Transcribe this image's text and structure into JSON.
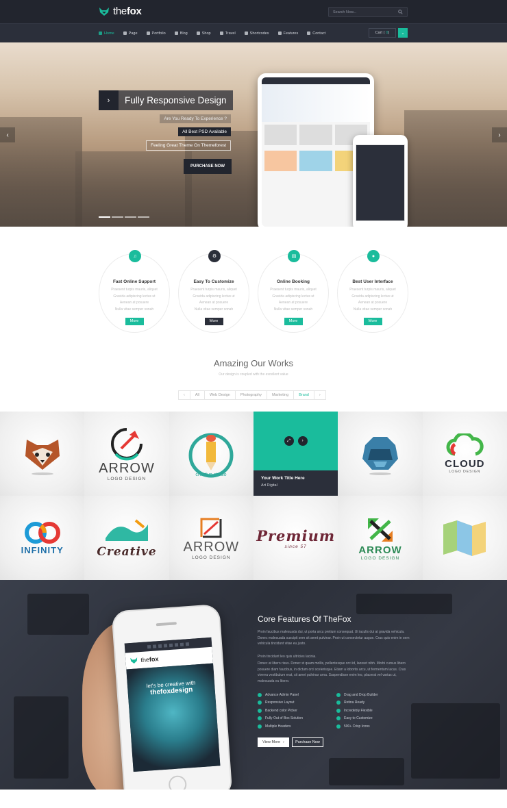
{
  "brand": {
    "name_light": "the",
    "name_bold": "fox",
    "accent": "#1abc9c",
    "dark": "#22252e"
  },
  "search": {
    "placeholder": "Search Now..."
  },
  "nav": {
    "items": [
      {
        "label": "Home",
        "icon": "home-icon"
      },
      {
        "label": "Page",
        "icon": "page-icon"
      },
      {
        "label": "Portfolio",
        "icon": "portfolio-icon"
      },
      {
        "label": "Blog",
        "icon": "blog-icon"
      },
      {
        "label": "Shop",
        "icon": "shop-icon"
      },
      {
        "label": "Travel",
        "icon": "travel-icon"
      },
      {
        "label": "Shortcodes",
        "icon": "shortcodes-icon"
      },
      {
        "label": "Features",
        "icon": "star-icon"
      },
      {
        "label": "Contact",
        "icon": "location-icon"
      }
    ],
    "cart_label": "Cart (",
    "cart_count": "0",
    "cart_close": ")"
  },
  "hero": {
    "title": "Fully Responsive Design",
    "tag1": "Are You Ready To Experience ?",
    "tag2": "All Best PSD Available",
    "tag3": "Feeling Great Theme On Themeforest",
    "button": "PURCHASE NOW",
    "slides_total": 4,
    "slide_active": 1
  },
  "features": [
    {
      "title": "Fast Online Support",
      "icon": "headphones-icon",
      "lines": [
        "Praesent turpis mauris, aliquet",
        "Gravida adipiscing lectus ut",
        "Aenean at posuere",
        "Nulla vitae semper sonah"
      ],
      "button": "More"
    },
    {
      "title": "Easy To Customize",
      "icon": "gear-icon",
      "lines": [
        "Praesent turpis mauris, aliquet",
        "Gravida adipiscing lectus ut",
        "Aenean at posuere",
        "Nulla vitae semper sonah"
      ],
      "button": "More"
    },
    {
      "title": "Online Booking",
      "icon": "book-icon",
      "lines": [
        "Praesent turpis mauris, aliquet",
        "Gravida adipiscing lectus ut",
        "Aenean at posuere",
        "Nulla vitae semper sonah"
      ],
      "button": "More"
    },
    {
      "title": "Best User Interface",
      "icon": "user-icon",
      "lines": [
        "Praesent turpis mauris, aliquet",
        "Gravida adipiscing lectus ut",
        "Aenean at posuere",
        "Nulla vitae semper sonah"
      ],
      "button": "More"
    }
  ],
  "works": {
    "title": "Amazing Our Works",
    "subtitle": "Our design is coupled with the excellent value",
    "filters": [
      "All",
      "Web Design",
      "Photography",
      "Marketing",
      "Brand"
    ],
    "active_filter": "Brand",
    "hover_title": "Your Work Title Here",
    "hover_sub": "Art Digital",
    "logos": {
      "arrow1": "ARROW",
      "arrow1_sub": "LOGO DESIGN",
      "creative_studio": "creative studio",
      "cloud": "CLOUD",
      "cloud_sub": "LOGO DESIGN",
      "infinity": "INFINITY",
      "creative": "Creative",
      "arrow2": "ARROW",
      "arrow2_sub": "LOGO DESIGN",
      "premium": "Premium",
      "premium_since": "since 57",
      "arrow3": "ARROW",
      "arrow3_sub": "LOGO DESIGN"
    }
  },
  "core": {
    "title": "Core Features Of TheFox",
    "p1": "Proin faucibus malesuada dui, ut porta arcu pretium consequat. Ut iaculis dui at gravida vehicula. Donec malesuada suscipit sem sit amet pulvinar. Proin ut consectetur augue. Cras quis enim in sem vehicula tincidunt vitae eu justo.",
    "p2": "Proin tincidunt leo quis ultricies lacinia.",
    "p3": "Donec at libero risus. Donec st quam mollis, pellentesque orci id, laoreet nibh. Morbi cursus libero posuere diam faucibus, in dictum orci scelerisque. Etiam a lobortis arcu, ut fermentum lacus. Cras viverra vestibulum erat, sit amet pulvinar urna. Suspendisse enim leo, placerat vel varius ut, malesuada eu libero.",
    "list_left": [
      "Advance Admin Panel",
      "Responsive Layout",
      "Backend color Picker",
      "Fully Out of Box Solution",
      "Multiple Headers"
    ],
    "list_right": [
      "Drag and Drop Builder",
      "Retina Ready",
      "Incredebly Flexible",
      "Easy to Customize",
      "500+ Crisp Icons"
    ],
    "btn1": "View More",
    "btn2": "Purchase Now",
    "phone_line1": "let's be creative with",
    "phone_line2": "thefoxdesign"
  }
}
